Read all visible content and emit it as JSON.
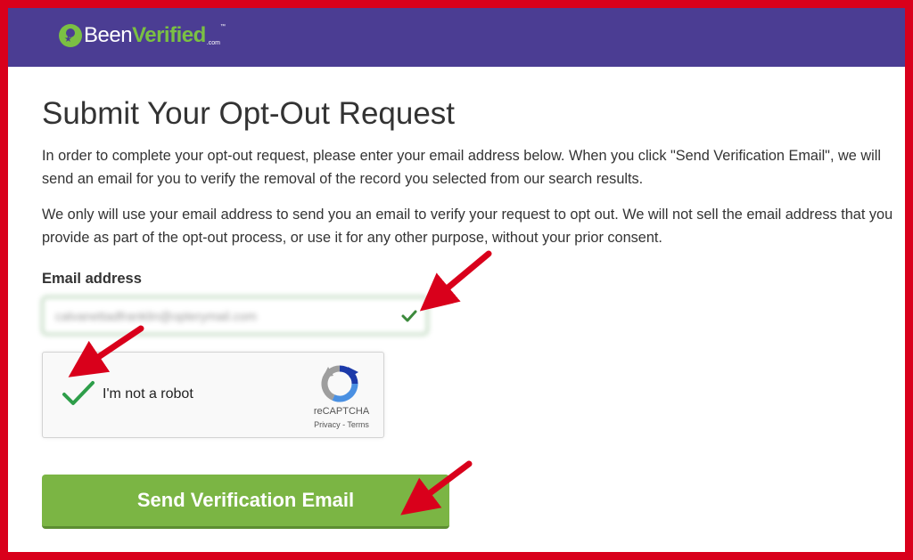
{
  "header": {
    "logo_text_been": "Been",
    "logo_text_verified": "Verified",
    "logo_text_com": ".com",
    "logo_tm": "™",
    "brand_color": "#4b3d93",
    "accent_color": "#7bc043"
  },
  "main": {
    "title": "Submit Your Opt-Out Request",
    "paragraph_1": "In order to complete your opt-out request, please enter your email address below. When you click \"Send Verification Email\", we will send an email for you to verify the removal of the record you selected from our search results.",
    "paragraph_2": "We only will use your email address to send you an email to verify your request to opt out. We will not sell the email address that you provide as part of the opt-out process, or use it for any other purpose, without your prior consent."
  },
  "form": {
    "email_label": "Email address",
    "email_value": "calvanettadfranklin@opterymail.com",
    "email_valid_icon": "checkmark-icon",
    "captcha": {
      "label": "I'm not a robot",
      "brand": "reCAPTCHA",
      "privacy": "Privacy",
      "separator": " - ",
      "terms": "Terms",
      "checked": true
    },
    "submit_label": "Send Verification Email",
    "submit_color": "#7bb544"
  },
  "annotations": {
    "frame_color": "#d9001b",
    "arrow_color": "#d9001b",
    "arrow_icon": "red-arrow-icon"
  }
}
